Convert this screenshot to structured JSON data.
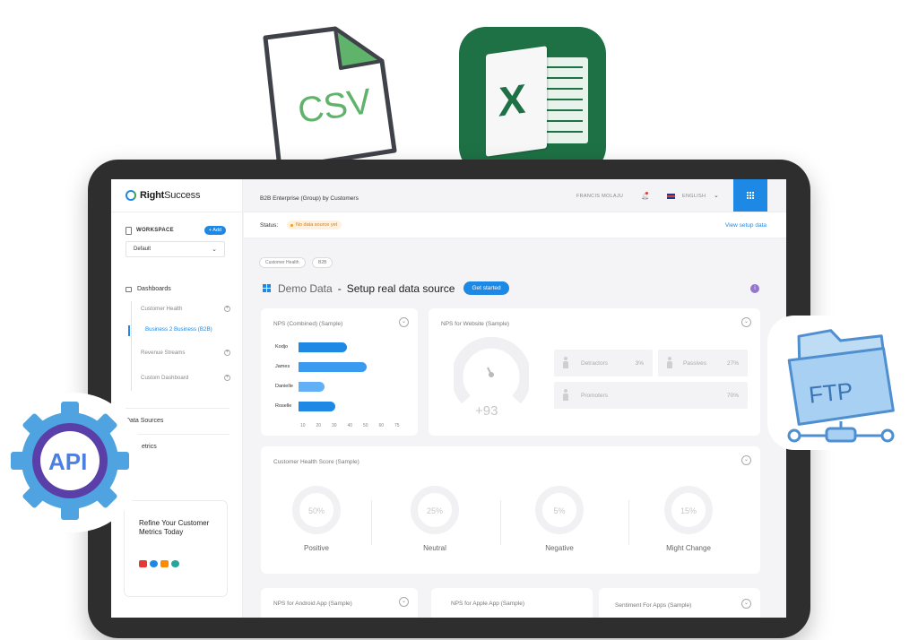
{
  "brand": {
    "name_bold": "Right",
    "name_rest": "Success"
  },
  "sidebar": {
    "workspace_label": "WORKSPACE",
    "add_label": "+ Add",
    "workspace_value": "Default",
    "dashboards_label": "Dashboards",
    "items": [
      "Customer Health",
      "Business 2 Business (B2B)",
      "Revenue Streams",
      "Custom Dashboard"
    ],
    "data_sources_label": "Data Sources",
    "metrics_label": "etrics",
    "promo_text": "Refine Your Customer Metrics Today"
  },
  "header": {
    "title": "B2B Enterprise (Group) by Customers",
    "user_name": "FRANCIS MOLAJU",
    "language": "ENGLISH"
  },
  "status": {
    "label": "Status:",
    "badge": "No data source yet",
    "view_setup": "View setup data"
  },
  "breadcrumb": [
    "Customer Health",
    "B2B"
  ],
  "page": {
    "demo": "Demo Data",
    "dash": "-",
    "setup": "Setup real data source",
    "get_started": "Get started",
    "info": "i"
  },
  "nps_combined": {
    "title": "NPS (Combined) (Sample)",
    "chart_data": {
      "type": "bar",
      "categories": [
        "Kodjo",
        "James",
        "Danielle",
        "Roselle"
      ],
      "values": [
        36,
        49,
        21,
        28
      ],
      "xlim": [
        10,
        75
      ],
      "ticks": [
        "10",
        "20",
        "30",
        "40",
        "50",
        "60",
        "75"
      ]
    }
  },
  "nps_website": {
    "title": "NPS for Website (Sample)",
    "score": "+93",
    "segments": [
      {
        "label": "Detractors",
        "value": "3%"
      },
      {
        "label": "Passives",
        "value": "27%"
      },
      {
        "label": "Promoters",
        "value": "70%"
      }
    ]
  },
  "health_score": {
    "title": "Customer Health Score (Sample)",
    "items": [
      {
        "value": "50%",
        "label": "Positive"
      },
      {
        "value": "25%",
        "label": "Neutral"
      },
      {
        "value": "5%",
        "label": "Negative"
      },
      {
        "value": "15%",
        "label": "Might Change"
      }
    ]
  },
  "bottom_cards": [
    "NPS for Android App (Sample)",
    "NPS for Apple App (Sample)",
    "Sentiment For Apps (Sample)"
  ],
  "floating": {
    "csv": "CSV",
    "excel": "X",
    "ftp": "FTP",
    "api": "API"
  },
  "colors": {
    "accent": "#1e88e5",
    "excel": "#1e7145",
    "csv_green": "#43a047",
    "ftp_blue": "#5aa9e6",
    "api_blue": "#4fa3e0",
    "api_purple": "#5a3fa8"
  }
}
